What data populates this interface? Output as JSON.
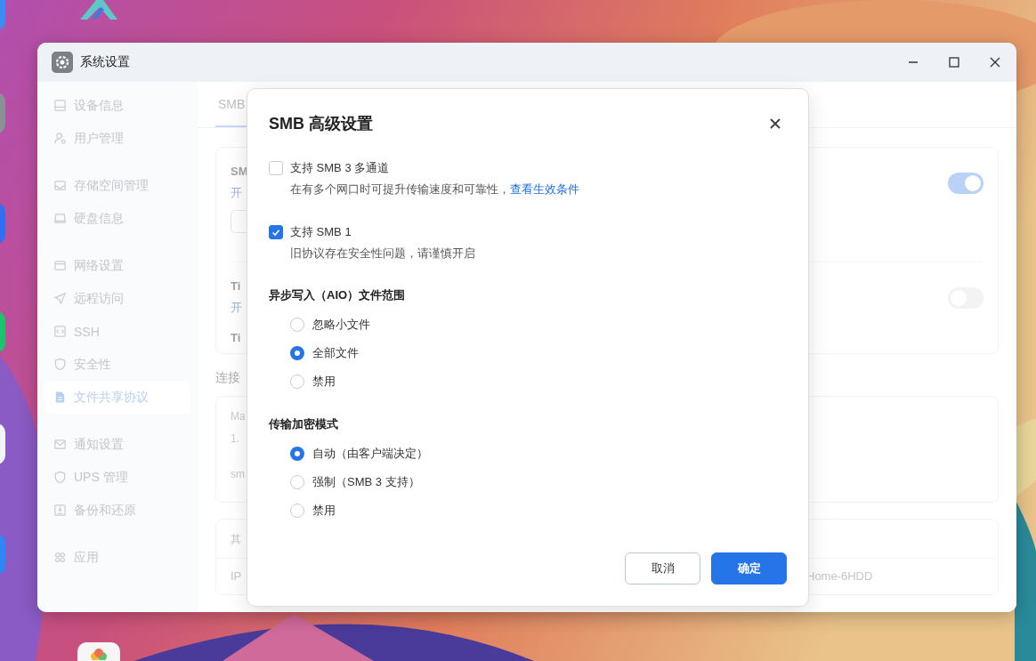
{
  "window": {
    "title": "系统设置",
    "sidebar": {
      "groups": [
        [
          {
            "label": "设备信息",
            "selected": false
          },
          {
            "label": "用户管理",
            "selected": false
          }
        ],
        [
          {
            "label": "存储空间管理",
            "selected": false
          },
          {
            "label": "硬盘信息",
            "selected": false
          }
        ],
        [
          {
            "label": "网络设置",
            "selected": false
          },
          {
            "label": "远程访问",
            "selected": false
          },
          {
            "label": "SSH",
            "selected": false
          },
          {
            "label": "安全性",
            "selected": false
          },
          {
            "label": "文件共享协议",
            "selected": true
          }
        ],
        [
          {
            "label": "通知设置",
            "selected": false
          },
          {
            "label": "UPS 管理",
            "selected": false
          },
          {
            "label": "备份和还原",
            "selected": false
          }
        ],
        [
          {
            "label": "应用",
            "selected": false
          }
        ]
      ]
    },
    "tabs": [
      {
        "label": "SMB",
        "selected": true
      }
    ],
    "card_1": {
      "rows": [
        {
          "title": "SM",
          "text": "开",
          "on": true
        },
        {
          "title": "Ti",
          "text": "开",
          "extra": "Ti",
          "on": false
        }
      ]
    },
    "section_title": "连接",
    "card_2": {
      "lines": [
        "Ma",
        "1.",
        "sm"
      ]
    },
    "card_3": {
      "title": "其",
      "label": "IP",
      "value": "Home-6HDD"
    }
  },
  "dialog": {
    "title": "SMB 高级设置",
    "options": [
      {
        "label": "支持 SMB 3 多通道",
        "checked": false,
        "description": "在有多个网口时可提升传输速度和可靠性，",
        "link": "查看生效条件"
      },
      {
        "label": "支持 SMB 1",
        "checked": true,
        "description": "旧协议存在安全性问题，请谨慎开启"
      }
    ],
    "groups": [
      {
        "title": "异步写入（AIO）文件范围",
        "choices": [
          {
            "label": "忽略小文件",
            "selected": false
          },
          {
            "label": "全部文件",
            "selected": true
          },
          {
            "label": "禁用",
            "selected": false
          }
        ]
      },
      {
        "title": "传输加密模式",
        "choices": [
          {
            "label": "自动（由客户端决定）",
            "selected": true
          },
          {
            "label": "强制（SMB 3 支持）",
            "selected": false
          },
          {
            "label": "禁用",
            "selected": false
          }
        ]
      }
    ],
    "buttons": [
      {
        "label": "取消",
        "kind": "secondary"
      },
      {
        "label": "确定",
        "kind": "primary"
      }
    ]
  }
}
